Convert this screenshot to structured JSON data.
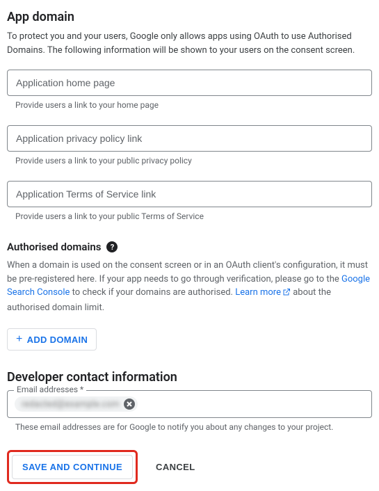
{
  "app_domain": {
    "title": "App domain",
    "description": "To protect you and your users, Google only allows apps using OAuth to use Authorised Domains. The following information will be shown to your users on the consent screen.",
    "fields": [
      {
        "placeholder": "Application home page",
        "helper": "Provide users a link to your home page"
      },
      {
        "placeholder": "Application privacy policy link",
        "helper": "Provide users a link to your public privacy policy"
      },
      {
        "placeholder": "Application Terms of Service link",
        "helper": "Provide users a link to your public Terms of Service"
      }
    ]
  },
  "authorised": {
    "title": "Authorised domains",
    "desc_pre": "When a domain is used on the consent screen or in an OAuth client's configuration, it must be pre-registered here. If your app needs to go through verification, please go to the ",
    "link1": "Google Search Console",
    "desc_mid": " to check if your domains are authorised. ",
    "link2": "Learn more",
    "desc_post": " about the authorised domain limit.",
    "add_label": "ADD DOMAIN"
  },
  "developer": {
    "title": "Developer contact information",
    "label": "Email addresses *",
    "chip_value": "redacted@example.com",
    "helper": "These email addresses are for Google to notify you about any changes to your project."
  },
  "actions": {
    "save": "SAVE AND CONTINUE",
    "cancel": "CANCEL"
  }
}
